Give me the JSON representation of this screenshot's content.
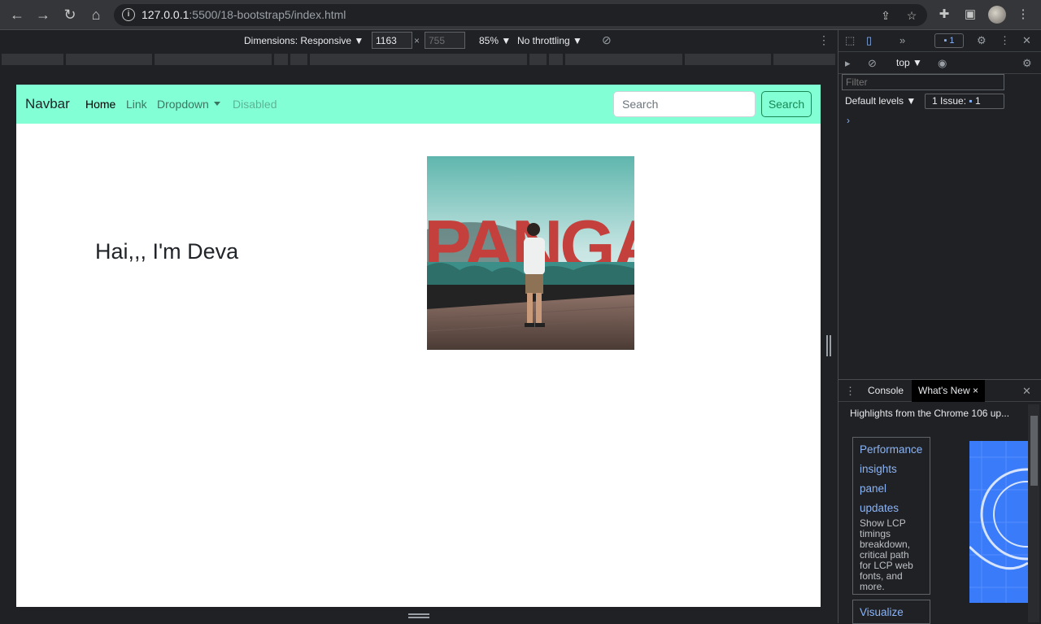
{
  "browser": {
    "url_host": "127.0.0.1",
    "url_rest": ":5500/18-bootstrap5/index.html"
  },
  "device_toolbar": {
    "dimensions_label": "Dimensions: Responsive ▼",
    "width_value": "1163",
    "height_value": "755",
    "times": "×",
    "zoom": "85% ▼",
    "throttling": "No throttling ▼"
  },
  "page": {
    "brand": "Navbar",
    "nav": {
      "home": "Home",
      "link": "Link",
      "dropdown": "Dropdown",
      "disabled": "Disabled"
    },
    "search_placeholder": "Search",
    "search_button": "Search",
    "heading": "Hai,,, I'm Deva",
    "photo_sign_text": "PANGAND",
    "navbar_color": "#83ffd6"
  },
  "devtools": {
    "context": "top ▼",
    "filter_placeholder": "Filter",
    "levels": "Default levels ▼",
    "issues_label": "1 Issue:",
    "issues_count": "1",
    "toolbar_badge_count": "1",
    "prompt": "›",
    "drawer": {
      "tabs": [
        "Console",
        "What's New"
      ],
      "close_tab": "×",
      "title": "Highlights from the Chrome 106 up...",
      "card_title_lines": [
        "Performance",
        "insights",
        "panel",
        "updates"
      ],
      "card_desc": "Show LCP timings breakdown, critical path for LCP web fonts, and more.",
      "next_card_title": "Visualize"
    }
  }
}
